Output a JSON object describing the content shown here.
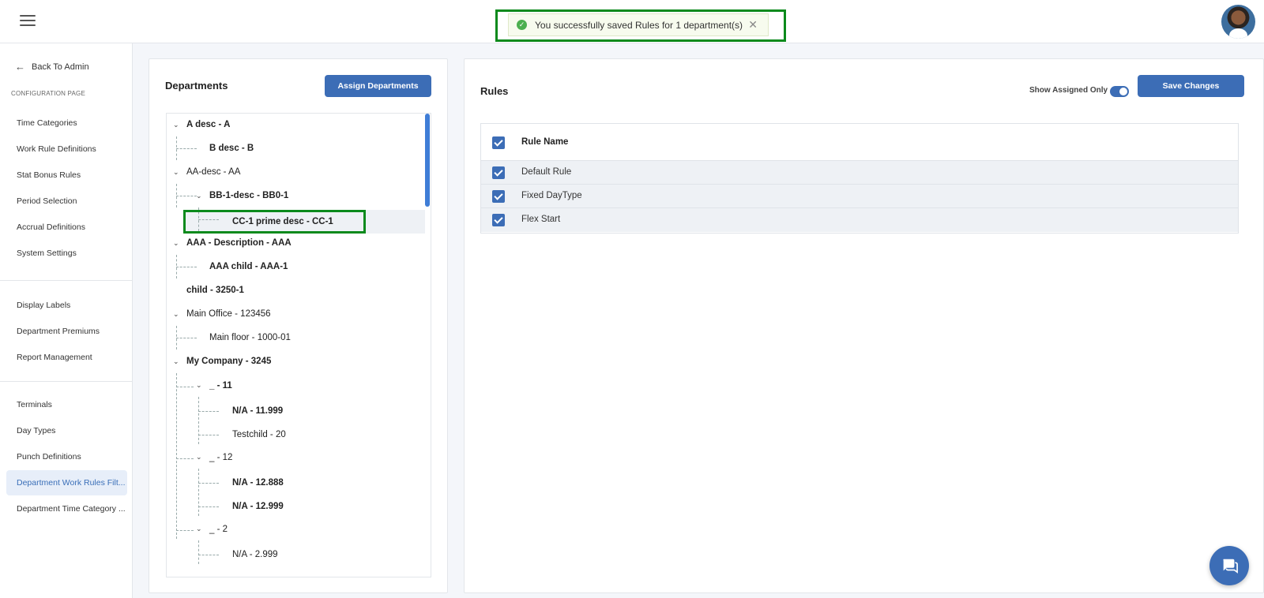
{
  "toast": {
    "message": "You successfully saved Rules for 1 department(s)",
    "close_glyph": "✕"
  },
  "sidebar": {
    "back_label": "Back To Admin",
    "section_label": "CONFIGURATION PAGE",
    "group1": [
      "Time Categories",
      "Work Rule Definitions",
      "Stat Bonus Rules",
      "Period Selection",
      "Accrual Definitions",
      "System Settings"
    ],
    "group2": [
      "Display Labels",
      "Department Premiums",
      "Report Management"
    ],
    "group3": [
      "Terminals",
      "Day Types",
      "Punch Definitions",
      "Department Work Rules Filt...",
      "Department Time Category ..."
    ],
    "active_item": "Department Work Rules Filt..."
  },
  "departments": {
    "title": "Departments",
    "assign_button": "Assign Departments",
    "tree": [
      {
        "label": "A desc - A",
        "bold": true
      },
      {
        "label": "B desc - B",
        "bold": true
      },
      {
        "label": "AA-desc - AA",
        "bold": false
      },
      {
        "label": "BB-1-desc - BB0-1",
        "bold": true
      },
      {
        "label": "CC-1 prime desc - CC-1",
        "bold": true
      },
      {
        "label": "AAA - Description - AAA",
        "bold": true
      },
      {
        "label": "AAA child - AAA-1",
        "bold": true
      },
      {
        "label": "child - 3250-1",
        "bold": true
      },
      {
        "label": "Main Office - 123456",
        "bold": false
      },
      {
        "label": "Main floor - 1000-01",
        "bold": false
      },
      {
        "label": "My Company - 3245",
        "bold": true
      },
      {
        "label": "_ - 11",
        "bold": true
      },
      {
        "label": "N/A - 11.999",
        "bold": true
      },
      {
        "label": "Testchild - 20",
        "bold": false
      },
      {
        "label": "_ - 12",
        "bold": false
      },
      {
        "label": "N/A - 12.888",
        "bold": true
      },
      {
        "label": "N/A - 12.999",
        "bold": true
      },
      {
        "label": "_ - 2",
        "bold": false
      },
      {
        "label": "N/A - 2.999",
        "bold": false
      }
    ],
    "selected": "CC-1 prime desc - CC-1"
  },
  "rules": {
    "title": "Rules",
    "toggle_label": "Show Assigned Only",
    "toggle_on": true,
    "save_button": "Save Changes",
    "column_header": "Rule Name",
    "rows": [
      {
        "name": "Default Rule",
        "checked": true
      },
      {
        "name": "Fixed DayType",
        "checked": true
      },
      {
        "name": "Flex Start",
        "checked": true
      }
    ]
  },
  "colors": {
    "accent": "#3c6db6",
    "success": "#4caf50",
    "highlight": "#0b8a1c"
  }
}
